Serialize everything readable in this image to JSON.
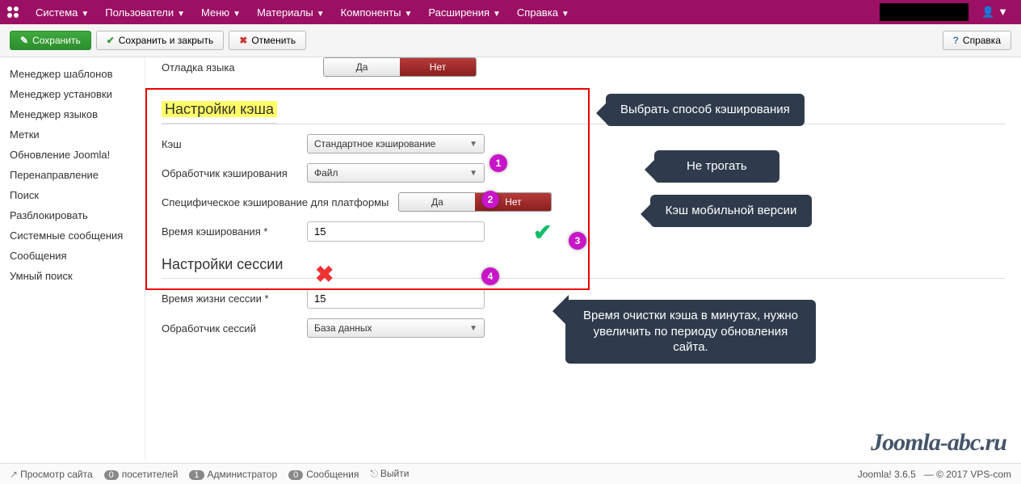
{
  "nav": {
    "items": [
      "Система",
      "Пользователи",
      "Меню",
      "Материалы",
      "Компоненты",
      "Расширения",
      "Справка"
    ]
  },
  "toolbar": {
    "save": "Сохранить",
    "save_close": "Сохранить и закрыть",
    "cancel": "Отменить",
    "help": "Справка"
  },
  "sidebar": {
    "items": [
      "Менеджер шаблонов",
      "Менеджер установки",
      "Менеджер языков",
      "Метки",
      "Обновление Joomla!",
      "Перенаправление",
      "Поиск",
      "Разблокировать",
      "Системные сообщения",
      "Сообщения",
      "Умный поиск"
    ]
  },
  "sections": {
    "lang_debug_label": "Отладка языка",
    "cache_title": "Настройки кэша",
    "cache_label": "Кэш",
    "cache_select": "Стандартное кэширование",
    "handler_label": "Обработчик кэширования",
    "handler_select": "Файл",
    "platform_label": "Специфическое кэширование для платформы",
    "cache_time_label": "Время кэширования *",
    "cache_time_value": "15",
    "session_title": "Настройки сессии",
    "session_life_label": "Время жизни сессии *",
    "session_life_value": "15",
    "session_handler_label": "Обработчик сессий",
    "session_handler_select": "База данных",
    "yes": "Да",
    "no": "Нет"
  },
  "annotations": {
    "a1": "Выбрать способ кэширования",
    "a2": "Не трогать",
    "a3": "Кэш мобильной версии",
    "a4": "Время очистки кэша в минутах, нужно увеличить по периоду обновления сайта.",
    "n1": "1",
    "n2": "2",
    "n3": "3",
    "n4": "4"
  },
  "watermark": "Joomla-abc.ru",
  "footer": {
    "preview": "Просмотр сайта",
    "visitors_badge": "0",
    "visitors": "посетителей",
    "admin_badge": "1",
    "admin": "Администратор",
    "msg_badge": "0",
    "msg": "Сообщения",
    "logout": "Выйти",
    "version": "Joomla! 3.6.5",
    "copy": "— © 2017 VPS-com"
  }
}
